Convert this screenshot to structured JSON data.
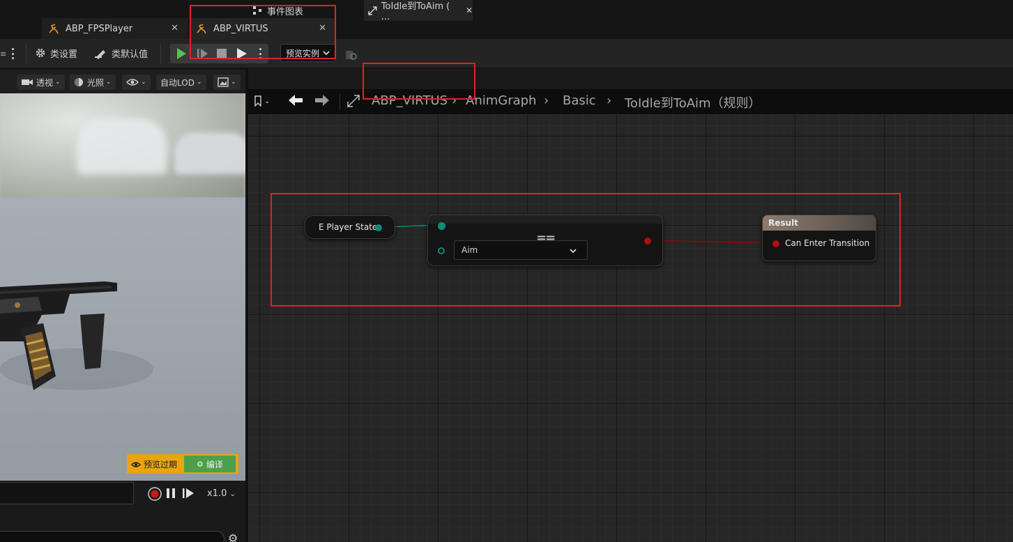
{
  "tabs": [
    {
      "label": "ABP_FPSPlayer"
    },
    {
      "label": "ABP_VIRTUS"
    }
  ],
  "toolbar": {
    "class_settings": "类设置",
    "class_defaults": "类默认值",
    "preview_instance": "预览实例"
  },
  "viewport": {
    "perspective": "透视",
    "lighting": "光照",
    "auto_lod": "自动LOD",
    "preview_outdated": "预览过期",
    "compile": "编译",
    "speed": "x1.0"
  },
  "graph_tabs": {
    "event_graph": "事件图表",
    "rule_tab": "ToIdle到ToAim ( ..."
  },
  "breadcrumb": [
    "ABP_VIRTUS",
    "AnimGraph",
    "Basic",
    "ToIdle到ToAim（规则）"
  ],
  "nodes": {
    "player_state": "E Player State",
    "equal_symbol": "==",
    "enum_value": "Aim",
    "result_title": "Result",
    "result_pin": "Can Enter Transition"
  },
  "colors": {
    "exec_teal": "#0d8a78",
    "bool_red": "#b40c0c",
    "highlight_red": "#e0222a",
    "compile_green": "#4ca04a",
    "warning_orange": "#e8a510"
  }
}
